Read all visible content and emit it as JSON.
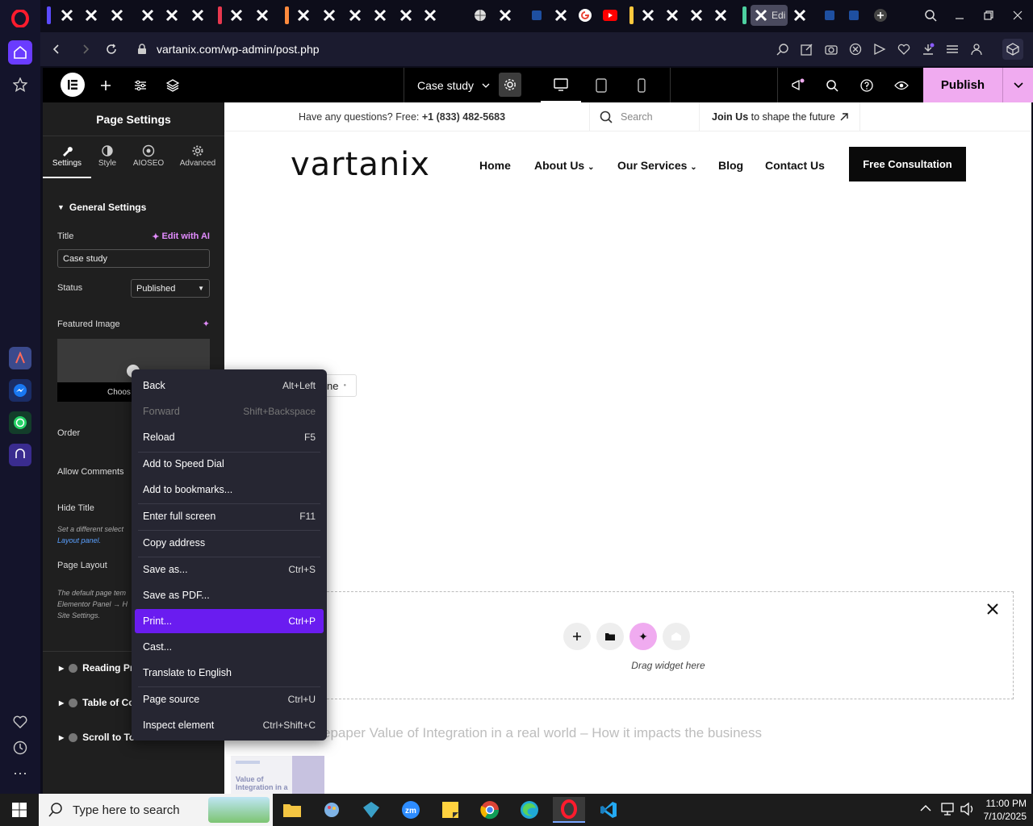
{
  "browser": {
    "url": "vartanix.com/wp-admin/post.php",
    "active_tab_label": "Edi"
  },
  "elementor": {
    "document_name": "Case study",
    "publish_label": "Publish"
  },
  "panel": {
    "title": "Page Settings",
    "tabs": [
      {
        "label": "Settings",
        "icon": "wrench-icon"
      },
      {
        "label": "Style",
        "icon": "contrast-icon"
      },
      {
        "label": "AIOSEO",
        "icon": "aioseo-icon"
      },
      {
        "label": "Advanced",
        "icon": "gear-icon"
      }
    ],
    "general_settings": "General Settings",
    "title_label": "Title",
    "edit_with_ai": "Edit with AI",
    "title_value": "Case study",
    "status_label": "Status",
    "status_value": "Published",
    "featured_image_label": "Featured Image",
    "choose_image": "Choos",
    "order_label": "Order",
    "allow_comments_label": "Allow Comments",
    "hide_title_label": "Hide Title",
    "hide_title_hint_1": "Set a different select",
    "hide_title_hint_2": "Layout panel.",
    "page_layout_label": "Page Layout",
    "page_layout_hint_1": "The default page tem",
    "page_layout_hint_2": "Elementor Panel → H",
    "page_layout_hint_3": "Site Settings.",
    "collapsed_sections": [
      "Reading Pr",
      "Table of Co",
      "Scroll to To"
    ]
  },
  "site": {
    "questions_text": "Have any questions? Free: ",
    "phone": "+1 (833) 482-5683",
    "search_placeholder": "Search",
    "join_bold": "Join Us",
    "join_rest": " to shape the future",
    "logo": "vartanix",
    "nav": [
      "Home",
      "About Us",
      "Our Services",
      "Blog",
      "Contact Us"
    ],
    "cta": "Free Consultation",
    "partial_button": "ne",
    "drag_widget": "Drag widget here",
    "post_title": "epaper Value of Integration in a real world – How it impacts the business",
    "thumb_text_1": "Value of",
    "thumb_text_2": "Integration in a"
  },
  "context_menu": [
    {
      "label": "Back",
      "shortcut": "Alt+Left",
      "disabled": false
    },
    {
      "label": "Forward",
      "shortcut": "Shift+Backspace",
      "disabled": true
    },
    {
      "label": "Reload",
      "shortcut": "F5",
      "disabled": false
    },
    {
      "label": "Add to Speed Dial",
      "shortcut": "",
      "disabled": false
    },
    {
      "label": "Add to bookmarks...",
      "shortcut": "",
      "disabled": false
    },
    {
      "label": "Enter full screen",
      "shortcut": "F11",
      "disabled": false
    },
    {
      "label": "Copy address",
      "shortcut": "",
      "disabled": false
    },
    {
      "label": "Save as...",
      "shortcut": "Ctrl+S",
      "disabled": false
    },
    {
      "label": "Save as PDF...",
      "shortcut": "",
      "disabled": false
    },
    {
      "label": "Print...",
      "shortcut": "Ctrl+P",
      "disabled": false,
      "highlighted": true
    },
    {
      "label": "Cast...",
      "shortcut": "",
      "disabled": false
    },
    {
      "label": "Translate to English",
      "shortcut": "",
      "disabled": false
    },
    {
      "label": "Page source",
      "shortcut": "Ctrl+U",
      "disabled": false
    },
    {
      "label": "Inspect element",
      "shortcut": "Ctrl+Shift+C",
      "disabled": false
    }
  ],
  "taskbar": {
    "search_placeholder": "Type here to search",
    "time": "11:00 PM",
    "date": "7/10/2025"
  },
  "colors": {
    "accent": "#6a1cf0",
    "publish": "#f0abf0",
    "opera_red": "#ff1b2d"
  }
}
